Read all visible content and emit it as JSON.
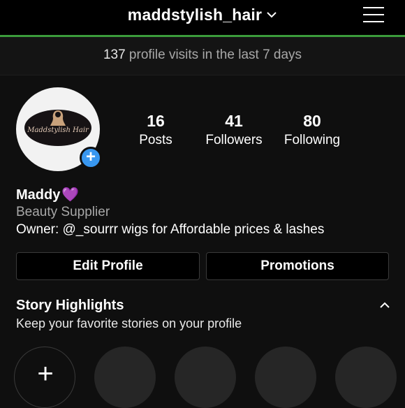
{
  "header": {
    "username": "maddstylish_hair",
    "menu_icon": "hamburger-menu-icon",
    "chevron_icon": "chevron-down-icon",
    "accent_line_color": "#3b9b3b"
  },
  "visits": {
    "count": "137",
    "text": " profile visits in the last 7 days"
  },
  "profile": {
    "avatar_logo_text": "Maddstylish Hair",
    "stats": [
      {
        "value": "16",
        "label": "Posts"
      },
      {
        "value": "41",
        "label": "Followers"
      },
      {
        "value": "80",
        "label": "Following"
      }
    ],
    "name": "Maddy",
    "name_emoji": "💜",
    "category": "Beauty Supplier",
    "bio": "Owner: @_sourrr wigs for Affordable prices & lashes"
  },
  "actions": {
    "edit_profile": "Edit Profile",
    "promotions": "Promotions"
  },
  "highlights": {
    "title": "Story Highlights",
    "subtitle": "Keep your favorite stories on your profile",
    "new_icon": "plus-icon",
    "collapse_icon": "chevron-up-icon"
  },
  "colors": {
    "background": "#0f0f0f",
    "add_button": "#3897f0",
    "secondary_text": "#a8a8a8"
  }
}
